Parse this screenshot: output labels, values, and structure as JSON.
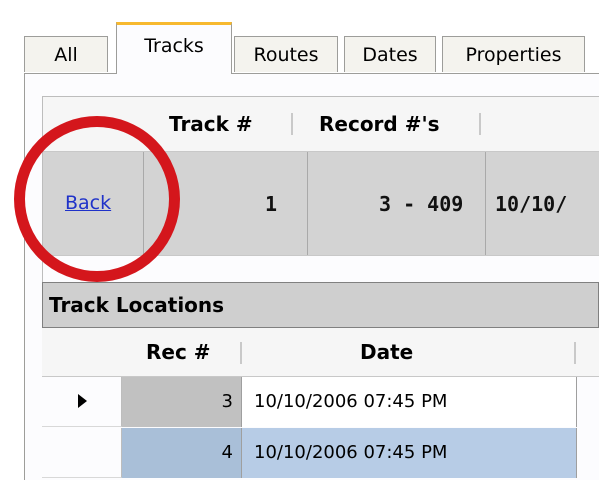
{
  "tabs": [
    {
      "label": "All"
    },
    {
      "label": "Tracks",
      "active": true
    },
    {
      "label": "Routes"
    },
    {
      "label": "Dates"
    },
    {
      "label": "Properties"
    }
  ],
  "record_grid": {
    "headers": [
      "Track #",
      "Record #'s"
    ],
    "row": {
      "back_label": "Back",
      "track_no": "1",
      "records": "3 - 409",
      "date_partial": "10/10/"
    }
  },
  "track_locations": {
    "title": "Track Locations",
    "headers": [
      "Rec #",
      "Date"
    ],
    "rows": [
      {
        "rec": "3",
        "date": "10/10/2006 07:45 PM",
        "current": true
      },
      {
        "rec": "4",
        "date": "10/10/2006 07:45 PM",
        "current": false
      }
    ]
  },
  "colors": {
    "annotation_circle": "#d4161c",
    "active_tab_accent": "#f7b92f",
    "link": "#1f32c9",
    "selected_row": "#b7cce6"
  }
}
